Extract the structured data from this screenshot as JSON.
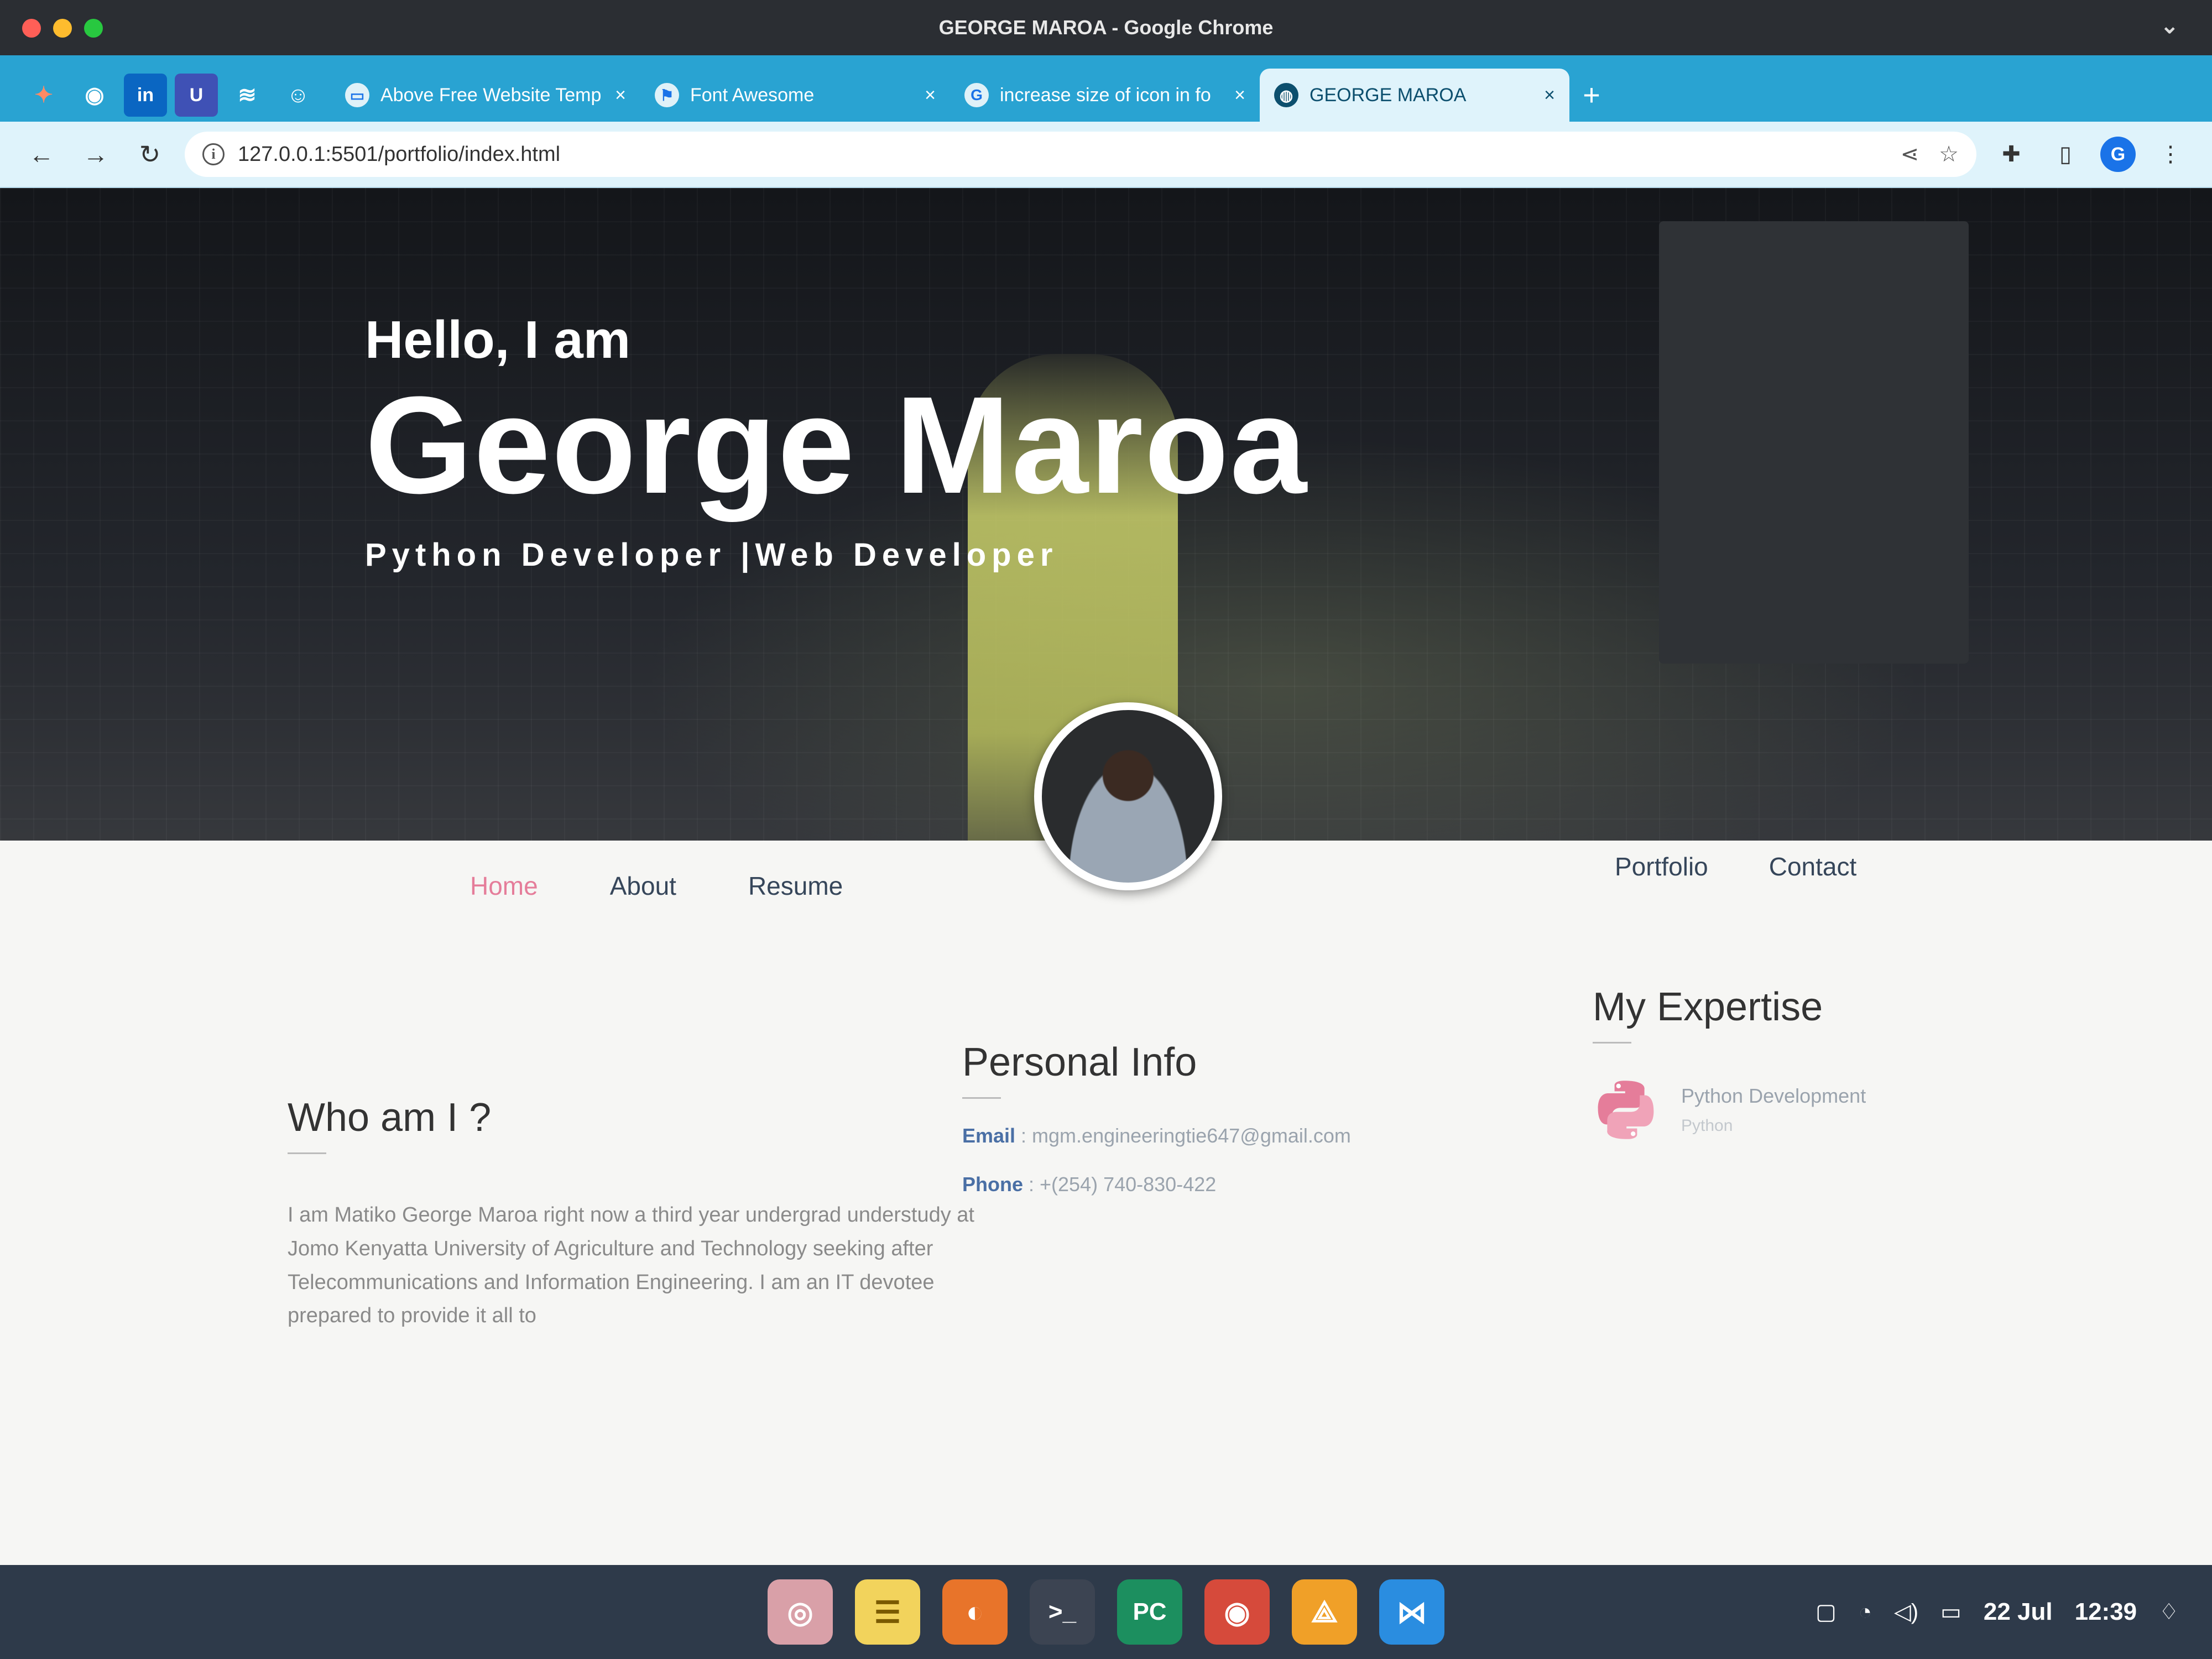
{
  "window": {
    "title": "GEORGE MAROA - Google Chrome"
  },
  "colors": {
    "tabstrip": "#29a3d2",
    "toolbar": "#dff3fb",
    "accent_pink": "#e57d9a",
    "nav_text": "#36465a",
    "link_blue": "#4a6fa5"
  },
  "pinned_tabs": [
    {
      "icon": "colorful-app-icon"
    },
    {
      "icon": "github-icon"
    },
    {
      "icon": "linkedin-icon",
      "glyph": "in"
    },
    {
      "icon": "u-app-icon",
      "glyph": "U"
    },
    {
      "icon": "wavy-app-icon"
    },
    {
      "icon": "copilot-icon"
    }
  ],
  "tabs": [
    {
      "title": "Above Free Website Temp",
      "icon": "page-icon"
    },
    {
      "title": "Font Awesome",
      "icon": "flag-icon"
    },
    {
      "title": "increase size of icon in fo",
      "icon": "google-icon",
      "glyph": "G"
    },
    {
      "title": "GEORGE MAROA",
      "icon": "globe-icon",
      "active": true
    }
  ],
  "new_tab_label": "+",
  "toolbar": {
    "url": "127.0.0.1:5501/portfolio/index.html",
    "profile_initial": "G"
  },
  "hero": {
    "greeting": "Hello, I am",
    "name": "George Maroa",
    "roles": "Python Developer |Web Developer"
  },
  "nav": {
    "left": [
      "Home",
      "About",
      "Resume"
    ],
    "right": [
      "Portfolio",
      "Contact"
    ]
  },
  "who": {
    "title": "Who am I ?",
    "text": "I am Matiko George Maroa right now a third year undergrad understudy at Jomo Kenyatta University of Agriculture and Technology seeking after Telecommunications and Information Engineering. I am an IT devotee prepared to provide it all to"
  },
  "personal": {
    "title": "Personal Info",
    "email_label": "Email",
    "email": ": mgm.engineeringtie647@gmail.com",
    "phone_label": "Phone",
    "phone": ": +(254) 740-830-422"
  },
  "expertise": {
    "title": "My Expertise",
    "item_title": "Python Development",
    "item_sub": "Python"
  },
  "taskbar": {
    "apps": [
      {
        "icon": "screenshot-app-icon",
        "color": "#d9a0a8"
      },
      {
        "icon": "notes-app-icon",
        "color": "#f2d35c"
      },
      {
        "icon": "firefox-icon",
        "color": "#e8742a"
      },
      {
        "icon": "terminal-icon",
        "glyph": ">_",
        "color": "#3c4452"
      },
      {
        "icon": "pycharm-icon",
        "glyph": "PC",
        "color": "#1c8f5f"
      },
      {
        "icon": "chrome-icon",
        "color": "#d64a3b"
      },
      {
        "icon": "diagram-app-icon",
        "color": "#f0a028"
      },
      {
        "icon": "vscode-icon",
        "color": "#2a8de0"
      }
    ],
    "date": "22 Jul",
    "time": "12:39"
  }
}
